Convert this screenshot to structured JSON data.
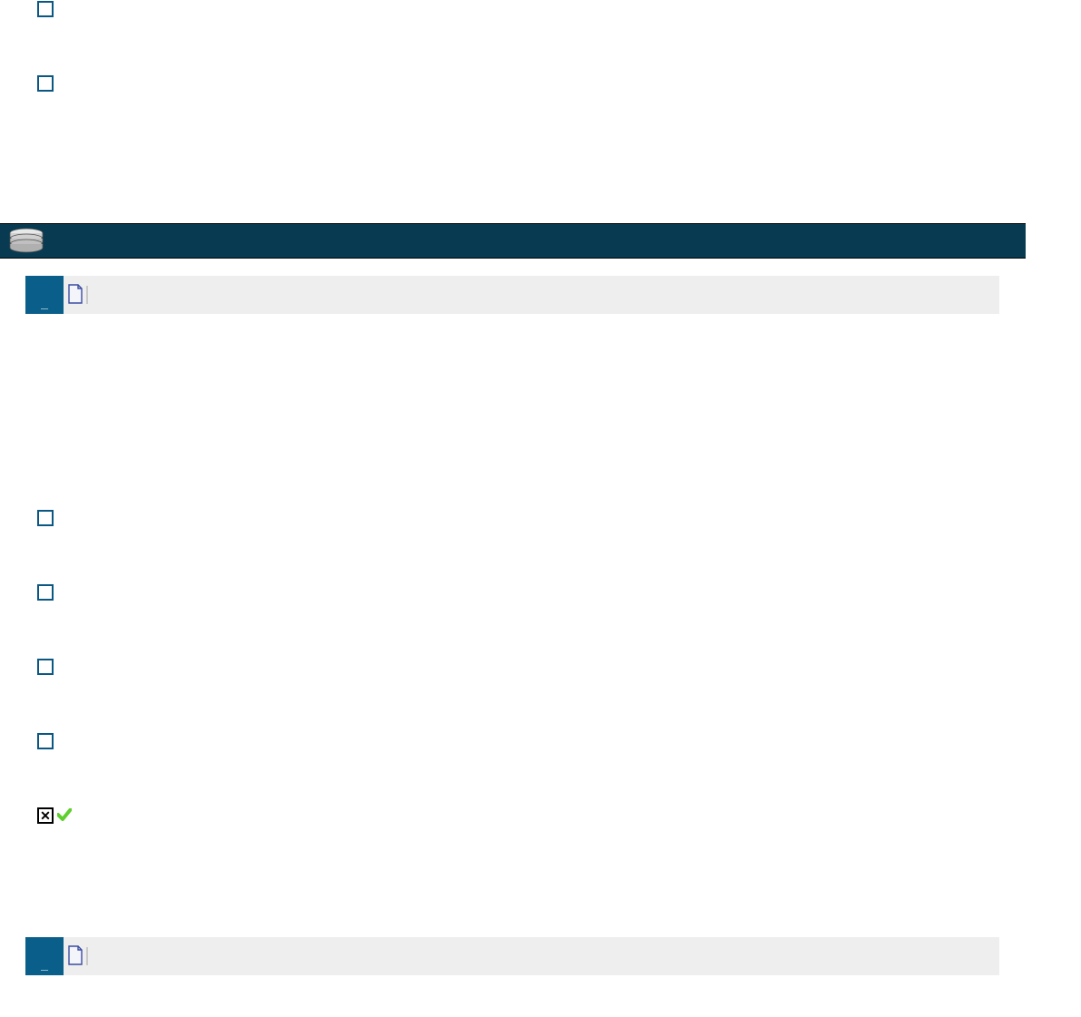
{
  "top_checkboxes": [
    {
      "checked": false
    },
    {
      "checked": false
    }
  ],
  "section1": {
    "badge": "_",
    "checkboxes": [
      {
        "checked": false
      },
      {
        "checked": false
      },
      {
        "checked": false
      },
      {
        "checked": false
      }
    ],
    "close_label": "✕"
  },
  "section2": {
    "badge": "_"
  }
}
